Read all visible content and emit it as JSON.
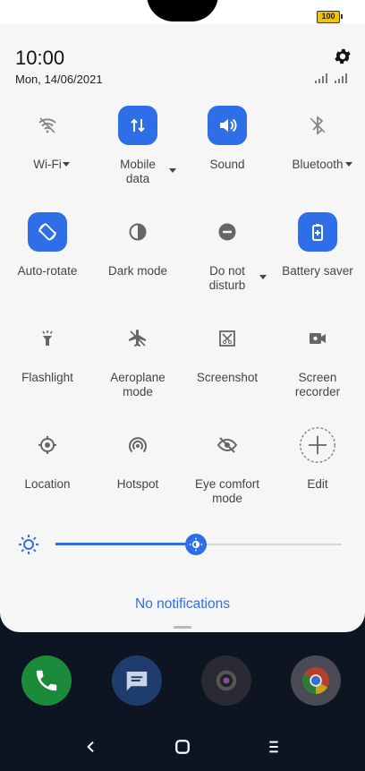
{
  "status": {
    "battery": "100"
  },
  "header": {
    "time": "10:00",
    "date": "Mon, 14/06/2021"
  },
  "tiles": [
    {
      "label": "Wi-Fi",
      "icon": "wifi-icon",
      "active": false
    },
    {
      "label": "Mobile data",
      "icon": "mobile-data-icon",
      "active": true
    },
    {
      "label": "Sound",
      "icon": "sound-icon",
      "active": true
    },
    {
      "label": "Bluetooth",
      "icon": "bluetooth-icon",
      "active": false
    },
    {
      "label": "Auto-rotate",
      "icon": "auto-rotate-icon",
      "active": true
    },
    {
      "label": "Dark mode",
      "icon": "dark-mode-icon",
      "active": false
    },
    {
      "label": "Do not disturb",
      "icon": "do-not-disturb-icon",
      "active": false
    },
    {
      "label": "Battery saver",
      "icon": "battery-saver-icon",
      "active": true
    },
    {
      "label": "Flashlight",
      "icon": "flashlight-icon",
      "active": false
    },
    {
      "label": "Aeroplane mode",
      "icon": "aeroplane-icon",
      "active": false
    },
    {
      "label": "Screenshot",
      "icon": "screenshot-icon",
      "active": false
    },
    {
      "label": "Screen recorder",
      "icon": "screen-recorder-icon",
      "active": false
    },
    {
      "label": "Location",
      "icon": "location-icon",
      "active": false
    },
    {
      "label": "Hotspot",
      "icon": "hotspot-icon",
      "active": false
    },
    {
      "label": "Eye comfort mode",
      "icon": "eye-comfort-icon",
      "active": false
    },
    {
      "label": "Edit",
      "icon": "edit-plus-icon",
      "active": false
    }
  ],
  "brightness": {
    "level": 0.49
  },
  "notifications": {
    "empty_text": "No notifications"
  },
  "colors": {
    "accent": "#2e6ee6",
    "panel": "#f6f6f7"
  }
}
